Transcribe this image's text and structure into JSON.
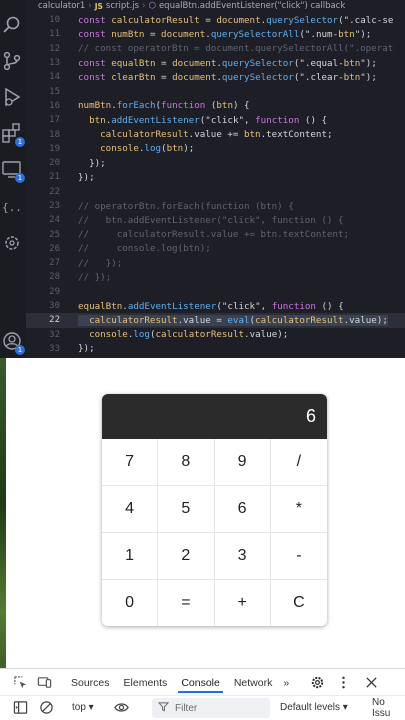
{
  "breadcrumb": {
    "folder": "calculator1",
    "file_badge": "JS",
    "file": "script.js",
    "symbol": "equalBtn.addEventListener(\"click\") callback"
  },
  "code_lines": [
    {
      "n": "10",
      "text": "const calculatorResult = document.querySelector(\".calc-se"
    },
    {
      "n": "11",
      "text": "const numBtn = document.querySelectorAll(\".num-btn\");"
    },
    {
      "n": "12",
      "text": "// const operatorBtn = document.querySelectorAll(\".operat"
    },
    {
      "n": "13",
      "text": "const equalBtn = document.querySelector(\".equal-btn\");"
    },
    {
      "n": "14",
      "text": "const clearBtn = document.querySelector(\".clear-btn\");"
    },
    {
      "n": "15",
      "text": ""
    },
    {
      "n": "16",
      "text": "numBtn.forEach(function (btn) {"
    },
    {
      "n": "17",
      "text": "  btn.addEventListener(\"click\", function () {"
    },
    {
      "n": "18",
      "text": "    calculatorResult.value += btn.textContent;"
    },
    {
      "n": "19",
      "text": "    console.log(btn);"
    },
    {
      "n": "20",
      "text": "  });"
    },
    {
      "n": "21",
      "text": "});"
    },
    {
      "n": "22",
      "text": ""
    },
    {
      "n": "23",
      "text": "// operatorBtn.forEach(function (btn) {"
    },
    {
      "n": "24",
      "text": "//   btn.addEventListener(\"click\", function () {"
    },
    {
      "n": "25",
      "text": "//     calculatorResult.value += btn.textContent;"
    },
    {
      "n": "26",
      "text": "//     console.log(btn);"
    },
    {
      "n": "27",
      "text": "//   });"
    },
    {
      "n": "28",
      "text": "// });"
    },
    {
      "n": "29",
      "text": ""
    },
    {
      "n": "30",
      "text": "equalBtn.addEventListener(\"click\", function () {"
    },
    {
      "n": "22",
      "text": "  calculatorResult.value = eval(calculatorResult.value);"
    },
    {
      "n": "32",
      "text": "  console.log(calculatorResult.value);"
    },
    {
      "n": "33",
      "text": "});"
    }
  ],
  "calculator": {
    "display_value": "6",
    "buttons": [
      "7",
      "8",
      "9",
      "/",
      "4",
      "5",
      "6",
      "*",
      "1",
      "2",
      "3",
      "-",
      "0",
      "=",
      "+",
      "C"
    ]
  },
  "devtools": {
    "tabs": [
      "Sources",
      "Elements",
      "Console",
      "Network"
    ],
    "more": "»",
    "context": "top ▾",
    "filter_placeholder": "Filter",
    "levels": "Default levels ▾",
    "issues": "No Issu"
  },
  "colors": {
    "editor_bg": "#1e1f26",
    "accent": "#1a73e8",
    "display_bg": "#2b2b2b"
  }
}
